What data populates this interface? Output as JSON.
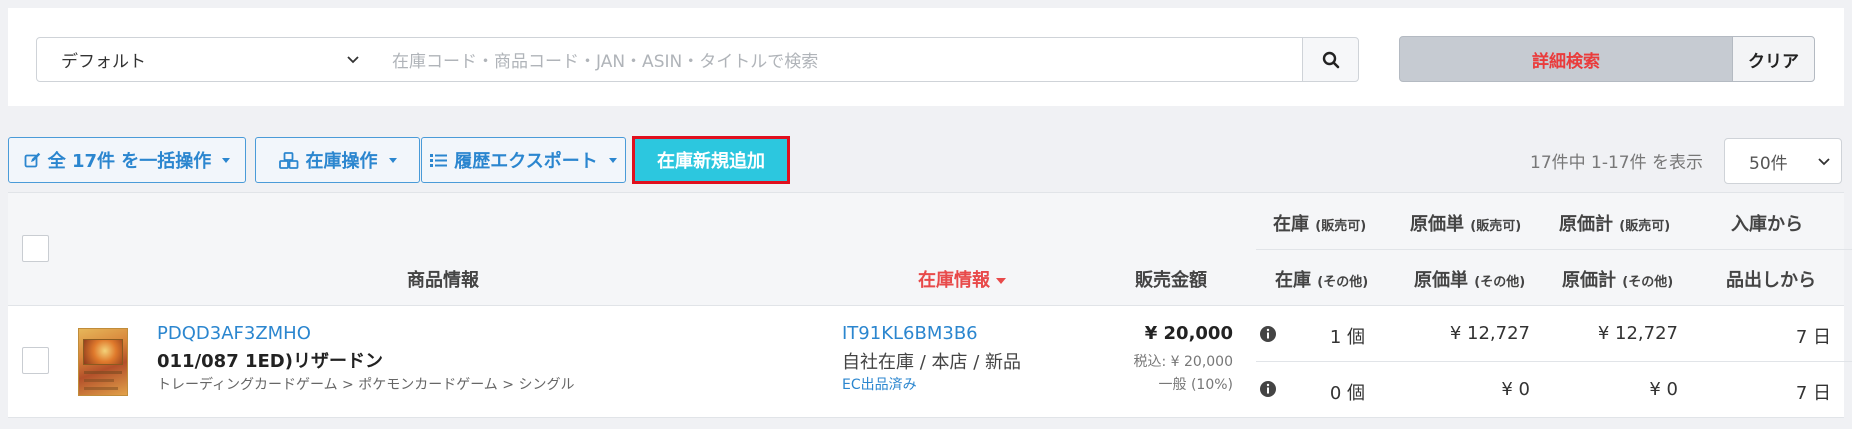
{
  "search": {
    "select_value": "デフォルト",
    "placeholder": "在庫コード・商品コード・JAN・ASIN・タイトルで検索",
    "detail_label": "詳細検索",
    "clear_label": "クリア"
  },
  "toolbar": {
    "bulk_label": "全 17件 を一括操作",
    "stock_ops_label": "在庫操作",
    "export_label": "履歴エクスポート",
    "add_label": "在庫新規追加",
    "count_text": "17件中 1-17件 を表示",
    "per_page": "50件"
  },
  "table": {
    "headers": {
      "product": "商品情報",
      "stock_info": "在庫情報",
      "price": "販売金額",
      "stock_top": "在庫",
      "stock_top_sub": "(販売可)",
      "stock_bottom": "在庫",
      "stock_bottom_sub": "(その他)",
      "unit_cost_top": "原価単",
      "unit_cost_top_sub": "(販売可)",
      "unit_cost_bottom": "原価単",
      "unit_cost_bottom_sub": "(その他)",
      "total_cost_top": "原価計",
      "total_cost_top_sub": "(販売可)",
      "total_cost_bottom": "原価計",
      "total_cost_bottom_sub": "(その他)",
      "since_in": "入庫から",
      "since_out": "品出しから"
    },
    "rows": [
      {
        "product_code": "PDQD3AF3ZMHO",
        "title": "011/087 1ED)リザードン",
        "category": "トレーディングカードゲーム > ポケモンカードゲーム > シングル",
        "stock_code": "IT91KL6BM3B6",
        "location": "自社在庫 / 本店 / 新品",
        "ec_status": "EC出品済み",
        "price": "¥ 20,000",
        "price_tax": "税込: ¥ 20,000",
        "tax_type": "一般 (10%)",
        "stock_sellable": "1 個",
        "stock_other": "0 個",
        "unit_cost_sellable": "¥ 12,727",
        "unit_cost_other": "¥ 0",
        "total_cost_sellable": "¥ 12,727",
        "total_cost_other": "¥ 0",
        "days_since_in": "7 日",
        "days_since_out": "7 日"
      }
    ]
  },
  "colors": {
    "accent_blue": "#2b86cf",
    "add_button": "#2cc7df",
    "highlight_border": "#e0101e",
    "detail_text": "#ea3c3c"
  },
  "icons": [
    "chevron-down-icon",
    "search-icon",
    "edit-icon",
    "cubes-icon",
    "list-icon",
    "info-icon"
  ]
}
